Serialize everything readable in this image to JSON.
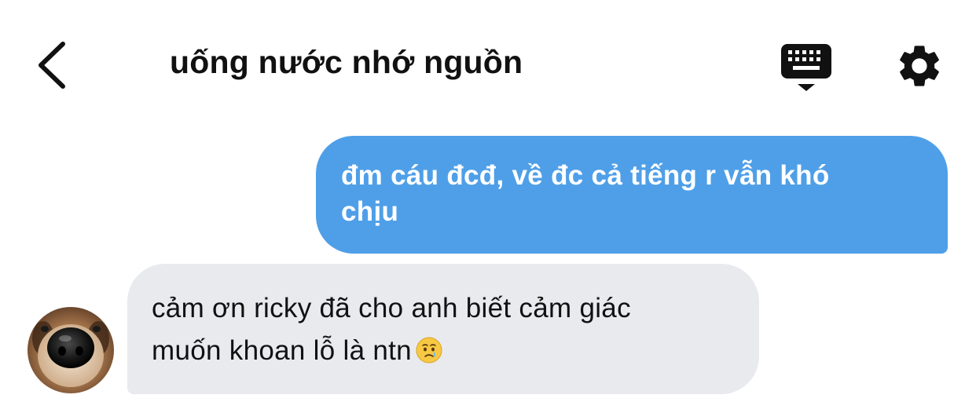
{
  "header": {
    "title": "uống nước nhớ nguồn",
    "back_icon": "chevron-left-icon",
    "keyboard_icon": "keyboard-icon",
    "settings_icon": "gear-icon"
  },
  "messages": [
    {
      "direction": "outgoing",
      "lines": [
        "đm cáu đcđ, về đc cả tiếng r vẫn khó",
        "chịu"
      ]
    },
    {
      "direction": "incoming",
      "lines": [
        "cảm ơn ricky đã cho anh biết cảm giác",
        "muốn khoan lỗ là ntn"
      ],
      "emoji": "tearful-face-emoji",
      "avatar": "dog-avatar"
    }
  ],
  "colors": {
    "outgoing_bubble": "#4f9fe8",
    "incoming_bubble": "#e8eaee",
    "text": "#111111"
  }
}
